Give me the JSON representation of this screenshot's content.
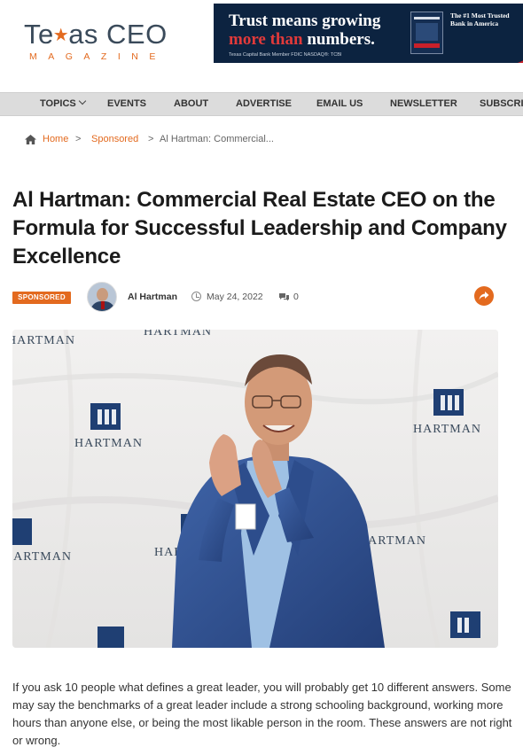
{
  "header": {
    "logo": {
      "main_part1": "Te",
      "main_star": "★",
      "main_part2": "as CEO",
      "sub": "MAGAZINE"
    },
    "ad": {
      "line1": "Trust means growing",
      "line2_accent": "more than",
      "line2_rest": " numbers.",
      "tagline": "The #1 Most Trusted Bank in America",
      "footer": "Texas Capital Bank   Member FDIC   NASDAQ®: TCBI",
      "colors": {
        "background": "#0c2340",
        "accent": "#c8202a"
      }
    }
  },
  "nav": {
    "items": [
      {
        "label": "TOPICS",
        "has_dropdown": true
      },
      {
        "label": "EVENTS"
      },
      {
        "label": "ABOUT"
      },
      {
        "label": "ADVERTISE"
      },
      {
        "label": "EMAIL US"
      },
      {
        "label": "NEWSLETTER"
      },
      {
        "label": "SUBSCRIBE"
      }
    ]
  },
  "breadcrumb": {
    "home": "Home",
    "sep": ">",
    "category": "Sponsored",
    "current": "Al Hartman: Commercial..."
  },
  "article": {
    "title": "Al Hartman: Commercial Real Estate CEO on the Formula for Successful Leadership and Company Excellence",
    "badge": "SPONSORED",
    "author": "Al Hartman",
    "date": "May 24, 2022",
    "comments": "0",
    "hero_backdrop_text": "HARTMAN",
    "paragraph": "If you ask 10 people what defines a great leader, you will probably get 10 different answers. Some may say the benchmarks of a great leader include a strong schooling background, working more hours than anyone else, or being the most likable person in the room. These answers are not right or wrong."
  },
  "colors": {
    "accent": "#e36a1f",
    "nav_bg": "#dcdcdc",
    "title": "#1b1b1b"
  },
  "icons": [
    "home-icon",
    "clock-icon",
    "comments-icon",
    "share-icon",
    "chevron-down-icon"
  ]
}
